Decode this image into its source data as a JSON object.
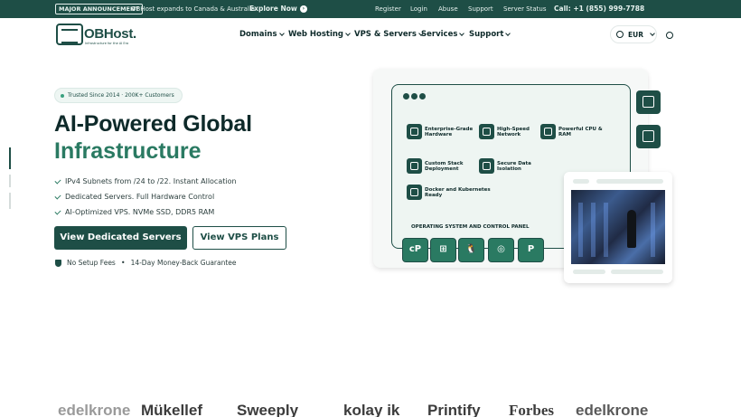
{
  "topbar": {
    "badge": "MAJOR ANNOUNCEMENT",
    "announcement": "OBHost expands to Canada & Australia",
    "cta": "Explore Now",
    "links": [
      "Register",
      "Login",
      "Abuse",
      "Support",
      "Server Status"
    ],
    "phone": "Call: +1 (855) 999-7788",
    "color": "#1e4e46"
  },
  "nav": {
    "logo_text": "OBHost.",
    "logo_tagline": "Infrastructure for the AI Era",
    "items": [
      "Domains",
      "Web Hosting",
      "VPS & Servers",
      "Services",
      "Support"
    ],
    "currency": "EUR"
  },
  "hero": {
    "pill": "Trusted Since 2014 · 200K+ Customers",
    "title_line1": "AI-Powered Global",
    "title_line2": "Infrastructure",
    "features": [
      "IPv4 Subnets from /24 to /22. Instant Allocation",
      "Dedicated Servers. Full Hardware Control",
      "AI-Optimized VPS. NVMe SSD, DDR5 RAM"
    ],
    "primary_button": "View Dedicated Servers",
    "secondary_button": "View VPS Plans",
    "guarantee_left": "No Setup Fees",
    "guarantee_sep": "•",
    "guarantee_right": "14-Day Money-Back Guarantee",
    "accent": "#2a7a62"
  },
  "illustration": {
    "features": [
      "Enterprise-Grade Hardware",
      "High-Speed Network",
      "Powerful CPU & RAM",
      "Custom Stack Deployment",
      "Secure Data Isolation",
      "Docker and Kubernetes Ready"
    ],
    "os_title": "OPERATING SYSTEM AND CONTROL PANEL",
    "os_icons": [
      "cP",
      "⊞",
      "🐧",
      "◎",
      "P"
    ]
  },
  "brands": [
    "edelkrone",
    "Mükellef",
    "Sweeply",
    "kolay ik",
    "Printify",
    "Forbes",
    "edelkrone"
  ]
}
